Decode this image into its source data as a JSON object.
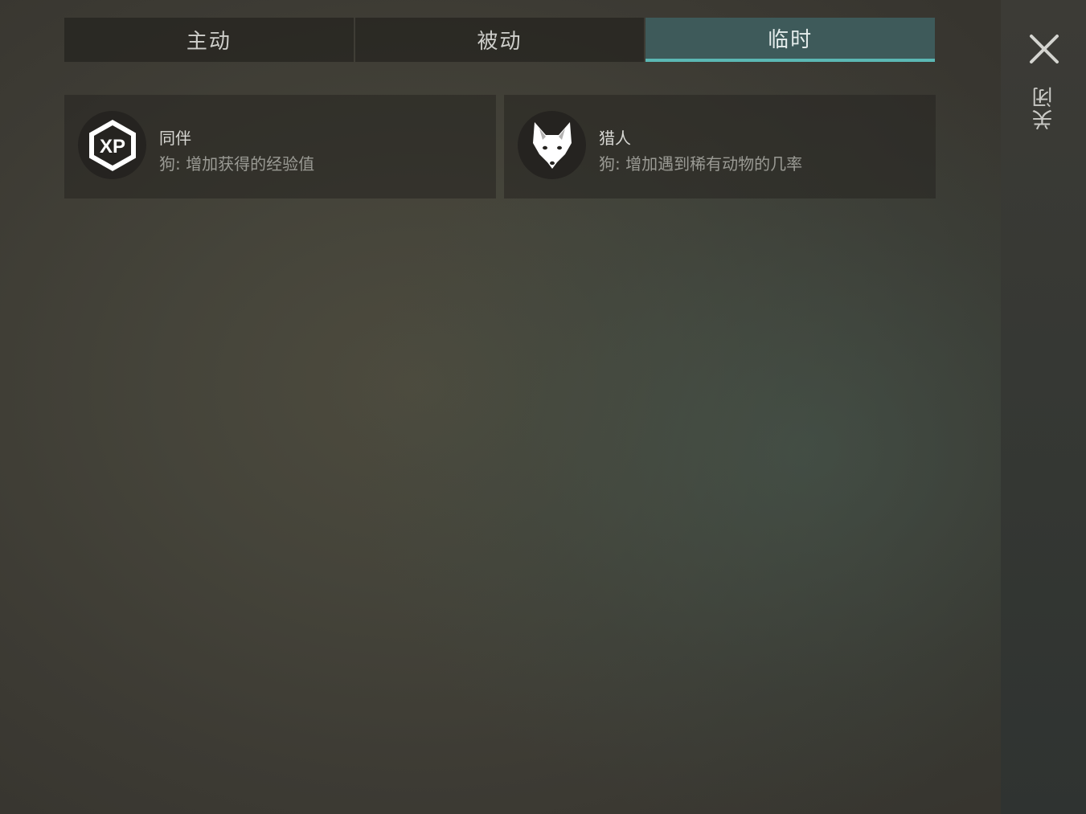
{
  "tabs": [
    {
      "label": "主动",
      "active": false
    },
    {
      "label": "被动",
      "active": false
    },
    {
      "label": "临时",
      "active": true
    }
  ],
  "cards": [
    {
      "title": "同伴",
      "description": "狗: 增加获得的经验值",
      "icon": "xp-hexagon-icon"
    },
    {
      "title": "猎人",
      "description": "狗: 增加遇到稀有动物的几率",
      "icon": "fox-head-icon"
    }
  ],
  "close": {
    "label": "关闭",
    "icon": "close-icon"
  },
  "colors": {
    "active_tab": "#3e5a5a",
    "active_tab_underline": "#5bb8b4",
    "card_bg": "#2a2925",
    "background": "#45443a"
  }
}
